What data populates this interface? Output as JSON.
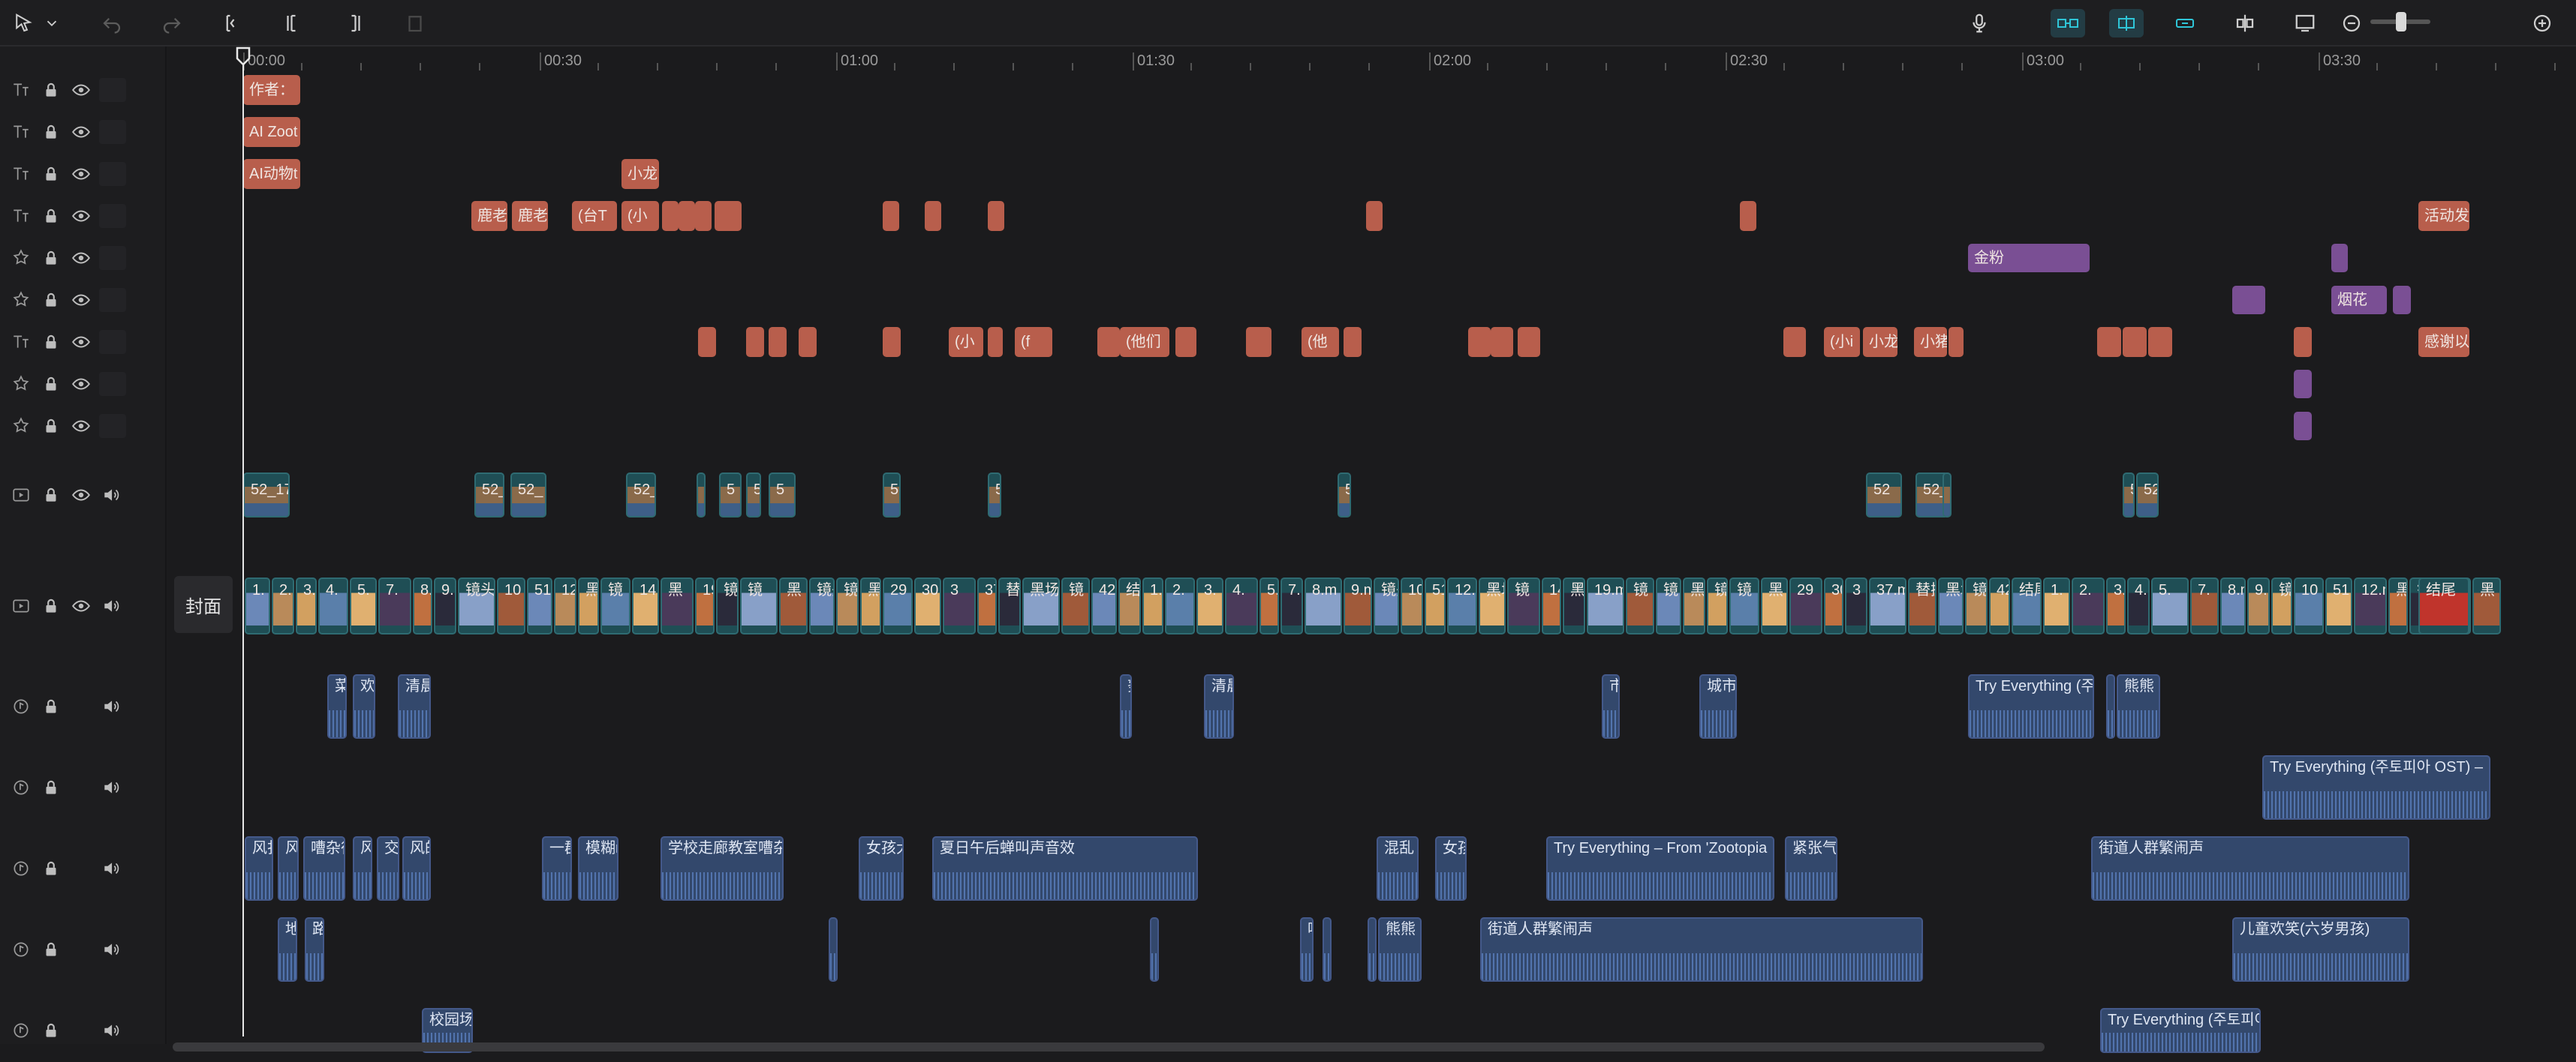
{
  "toolbar": {
    "tools_left": [
      "select-icon",
      "chevron-down-icon",
      "undo-icon",
      "redo-icon",
      "split-icon",
      "split-left-icon",
      "split-right-icon",
      "delete-icon"
    ],
    "tools_right": [
      "microphone-icon",
      "link-icon",
      "magnet-icon",
      "chain-icon",
      "split-preview-icon",
      "preview-icon",
      "zoom-out-icon",
      "zoom-in-icon"
    ]
  },
  "ruler": {
    "labels": [
      "00:00",
      "00:30",
      "01:00",
      "01:30",
      "02:00",
      "02:30",
      "03:00",
      "03:30"
    ]
  },
  "track_headers": [
    {
      "type": "text"
    },
    {
      "type": "text"
    },
    {
      "type": "text"
    },
    {
      "type": "text"
    },
    {
      "type": "effect"
    },
    {
      "type": "effect"
    },
    {
      "type": "text"
    },
    {
      "type": "effect"
    },
    {
      "type": "effect"
    },
    {
      "type": "video"
    },
    {
      "type": "video-main"
    },
    {
      "type": "audio"
    },
    {
      "type": "audio"
    },
    {
      "type": "audio"
    },
    {
      "type": "audio"
    },
    {
      "type": "audio"
    }
  ],
  "cover_label": "封面",
  "text_clips": [
    {
      "label": "作者： "
    },
    {
      "label": "AI Zoot"
    },
    {
      "label": "AI动物t"
    },
    {
      "label": "小龙"
    },
    {
      "label": "鹿老"
    },
    {
      "label": "鹿老"
    },
    {
      "label": "(台T"
    },
    {
      "label": "(小"
    },
    {
      "label": "活动发"
    },
    {
      "label": "(小"
    },
    {
      "label": "(f"
    },
    {
      "label": "(他们"
    },
    {
      "label": "(他"
    },
    {
      "label": "(小i"
    },
    {
      "label": "小龙"
    },
    {
      "label": "小猪"
    },
    {
      "label": "感谢以"
    }
  ],
  "effect_clips": [
    {
      "label": "金粉"
    },
    {
      "label": "烟花"
    }
  ],
  "video_labels": [
    "52_17",
    "52_",
    "52_",
    "52_",
    "52",
    "5",
    "5",
    "5",
    "52_",
    "52_",
    "5",
    "52"
  ],
  "main_video_labels": [
    "1.",
    "2.",
    "3.",
    "4.",
    "5.",
    "7.",
    "8.m",
    "9.m",
    "镜头",
    "10",
    "51",
    "12.m",
    "黑场",
    "镜",
    "14",
    "黑",
    "19.m",
    "镜",
    "镜",
    "黑",
    "镜头",
    "镜",
    "黑",
    "29",
    "30.",
    "3",
    "37.m",
    "替换",
    "黑场",
    "镜",
    "42",
    "结尾"
  ],
  "audio_clips": [
    {
      "label": "菜"
    },
    {
      "label": "欢"
    },
    {
      "label": "清晨"
    },
    {
      "label": "努"
    },
    {
      "label": "清晨"
    },
    {
      "label": "市"
    },
    {
      "label": "城市"
    },
    {
      "label": "Try Everything (주"
    },
    {
      "label": "熊熊"
    },
    {
      "label": "Try Everything (주토피아 OST) – "
    },
    {
      "label": "风扑"
    },
    {
      "label": "风"
    },
    {
      "label": "嘈杂征"
    },
    {
      "label": "风"
    },
    {
      "label": "交"
    },
    {
      "label": "风的"
    },
    {
      "label": "一群"
    },
    {
      "label": "模糊n"
    },
    {
      "label": "学校走廊教室嘈杂"
    },
    {
      "label": "女孩大"
    },
    {
      "label": "夏日午后蝉叫声音效"
    },
    {
      "label": "混乱"
    },
    {
      "label": "女孩"
    },
    {
      "label": "Try Everything – From 'Zootopia"
    },
    {
      "label": "紧张气"
    },
    {
      "label": "街道人群繁闹声"
    },
    {
      "label": "地"
    },
    {
      "label": "路"
    },
    {
      "label": "哆"
    },
    {
      "label": "熊熊"
    },
    {
      "label": "街道人群繁闹声"
    },
    {
      "label": "儿童欢笑(六岁男孩)"
    },
    {
      "label": "校园场"
    },
    {
      "label": "Try Everything (주토피아"
    }
  ],
  "colors": {
    "text_clip": "#b85e4c",
    "effect_clip": "#7a4f94",
    "video_clip": "#1f4e55",
    "audio_clip": "#33486c",
    "accent": "#2fc6d8",
    "playhead": "#e8e8e8"
  }
}
